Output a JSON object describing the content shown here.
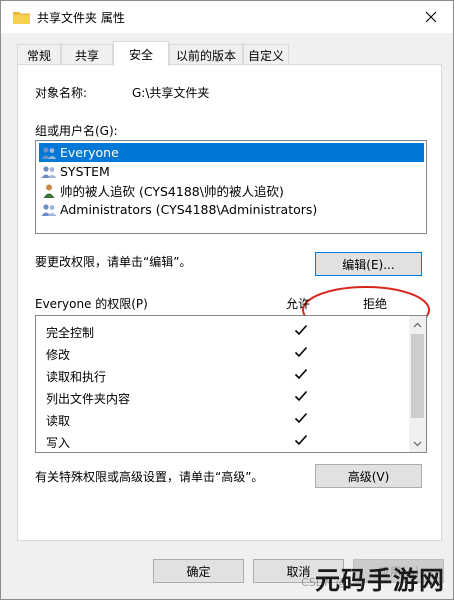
{
  "window": {
    "title": "共享文件夹 属性",
    "close_glyph": "✕"
  },
  "tabs": [
    {
      "label": "常规"
    },
    {
      "label": "共享"
    },
    {
      "label": "安全"
    },
    {
      "label": "以前的版本"
    },
    {
      "label": "自定义"
    }
  ],
  "security": {
    "object_label": "对象名称:",
    "object_value": "G:\\共享文件夹",
    "group_label": "组或用户名(G):",
    "users": [
      {
        "name": "Everyone",
        "icon": "users-group-icon"
      },
      {
        "name": "SYSTEM",
        "icon": "users-group-icon"
      },
      {
        "name": "帅的被人追砍 (CYS4188\\帅的被人追砍)",
        "icon": "user-icon"
      },
      {
        "name": "Administrators (CYS4188\\Administrators)",
        "icon": "users-group-icon"
      }
    ],
    "selected_user": 0,
    "change_hint": "要更改权限，请单击“编辑”。",
    "edit_button": "编辑(E)...",
    "perm_header": "Everyone 的权限(P)",
    "allow_header": "允许",
    "deny_header": "拒绝",
    "permissions": [
      {
        "name": "完全控制",
        "allow": true,
        "deny": false
      },
      {
        "name": "修改",
        "allow": true,
        "deny": false
      },
      {
        "name": "读取和执行",
        "allow": true,
        "deny": false
      },
      {
        "name": "列出文件夹内容",
        "allow": true,
        "deny": false
      },
      {
        "name": "读取",
        "allow": true,
        "deny": false
      },
      {
        "name": "写入",
        "allow": true,
        "deny": false
      }
    ],
    "advanced_hint": "有关特殊权限或高级设置，请单击“高级”。",
    "advanced_button": "高级(V)"
  },
  "footer": {
    "ok_button": "确定",
    "cancel_button": "取消",
    "apply_button": "应用(A)"
  },
  "watermark": {
    "csdn": "CSDN @",
    "brand": "元码手游网"
  },
  "colors": {
    "selection": "#0078d7",
    "annotation": "#d9261c",
    "folder": "#e8b73c"
  }
}
